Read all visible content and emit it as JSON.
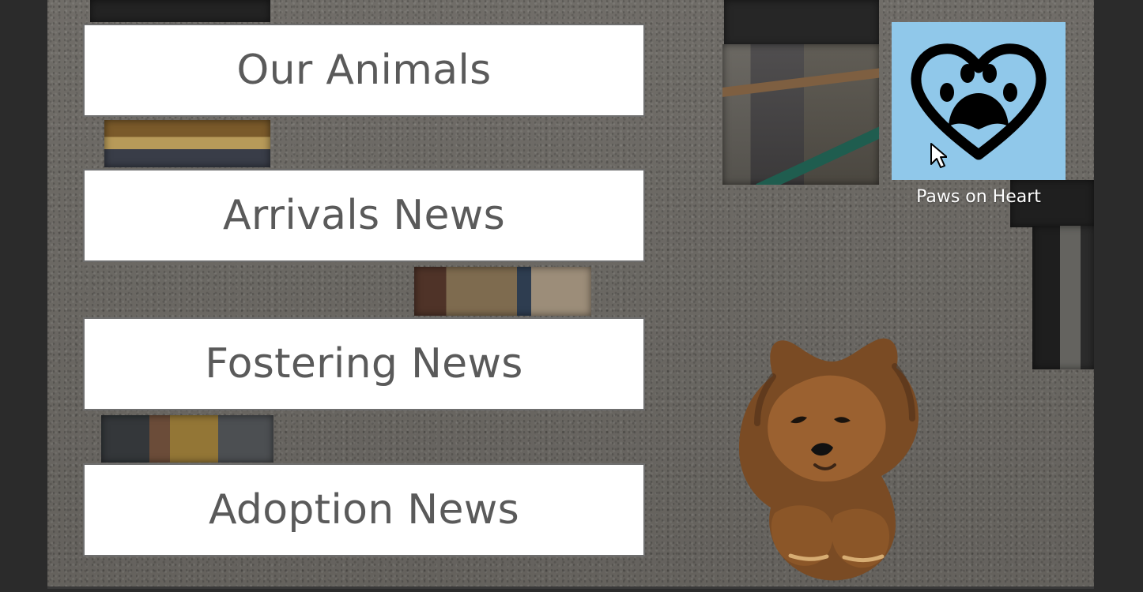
{
  "menu": {
    "items": [
      {
        "label": "Our Animals"
      },
      {
        "label": "Arrivals News"
      },
      {
        "label": "Fostering News"
      },
      {
        "label": "Adoption News"
      }
    ]
  },
  "brand": {
    "name": "Paws on Heart",
    "tile_color": "#90c8ea",
    "icon": "heart-paw-icon"
  },
  "colors": {
    "background": "#6d6a65",
    "button_background": "#ffffff",
    "button_text": "#5a5a5a"
  }
}
